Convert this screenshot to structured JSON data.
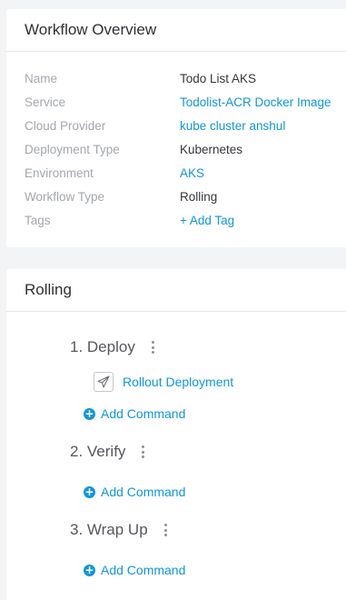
{
  "overview": {
    "title": "Workflow Overview",
    "rows": [
      {
        "label": "Name",
        "value": "Todo List AKS"
      },
      {
        "label": "Service",
        "value": "Todolist-ACR Docker Image"
      },
      {
        "label": "Cloud Provider",
        "value": "kube cluster anshul"
      },
      {
        "label": "Deployment Type",
        "value": "Kubernetes"
      },
      {
        "label": "Environment",
        "value": "AKS"
      },
      {
        "label": "Workflow Type",
        "value": "Rolling"
      },
      {
        "label": "Tags",
        "value": "+ Add Tag"
      }
    ]
  },
  "rolling": {
    "title": "Rolling",
    "phases": [
      {
        "name": "1. Deploy",
        "steps": [
          {
            "name": "Rollout Deployment",
            "icon": "paper-plane-icon"
          }
        ],
        "add_command": "Add Command"
      },
      {
        "name": "2. Verify",
        "steps": [],
        "add_command": "Add Command"
      },
      {
        "name": "3. Wrap Up",
        "steps": [],
        "add_command": "Add Command"
      }
    ]
  },
  "colors": {
    "link": "#0f96dc",
    "label": "#a3a7ad",
    "background": "#f3f4f6"
  }
}
